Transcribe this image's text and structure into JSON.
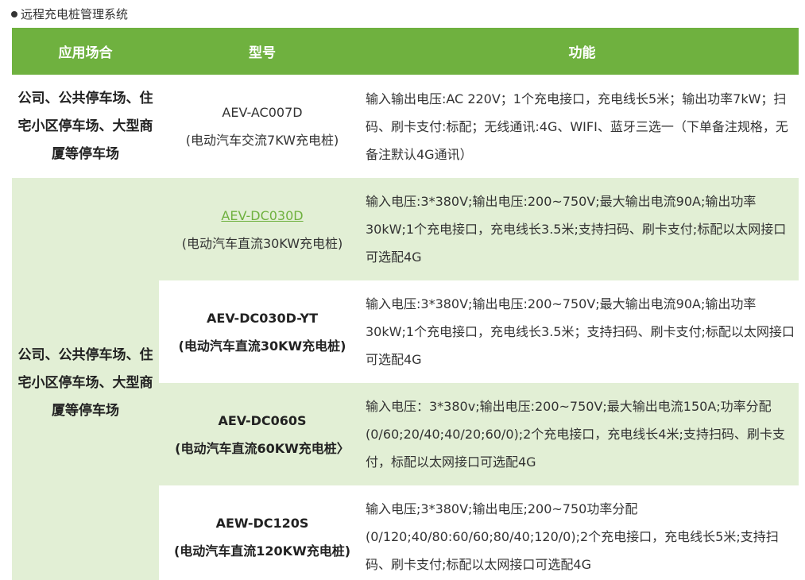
{
  "section": {
    "title": "远程充电桩管理系统"
  },
  "table": {
    "headers": {
      "scenario": "应用场合",
      "model": "型号",
      "function": "功能"
    },
    "rows": [
      {
        "scenario": "公司、公共停车场、住宅小区停车场、大型商厦等停车场",
        "model": "AEV-AC007D",
        "model_desc": "(电动汽车交流7KW充电桩)",
        "function": "输入输出电压:AC 220V；1个充电接口，充电线长5米；输出功率7kW；扫码、刷卡支付:标配；无线通讯:4G、WIFI、蓝牙三选一（下单备注规格，无备注默认4G通讯）"
      },
      {
        "scenario": "公司、公共停车场、住宅小区停车场、大型商厦等停车场",
        "model": "AEV-DC030D",
        "model_desc": "(电动汽车直流30KW充电桩)",
        "function": "输入电压:3*380V;输出电压:200~750V;最大输出电流90A;输出功率30kW;1个充电接口，充电线长3.5米;支持扫码、刷卡支付;标配以太网接口可选配4G"
      },
      {
        "model": "AEV-DC030D-YT",
        "model_desc": "(电动汽车直流30KW充电桩)",
        "function": "输入电压:3*380V;输出电压:200~750V;最大输出电流90A;输出功率30kW;1个充电接口，充电线长3.5米；支持扫码、刷卡支付;标配以太网接口可选配4G"
      },
      {
        "model": "AEV-DC060S",
        "model_desc": "(电动汽车直流60KW充电桩〉",
        "function": "输入电压：3*380v;输出电压:200~750V;最大输出电流150A;功率分配(0/60;20/40;40/20;60/0);2个充电接口，充电线长4米;支持扫码、刷卡支付，标配以太网接口可选配4G"
      },
      {
        "model": "AEW-DC120S",
        "model_desc": "(电动汽车直流120KW充电桩)",
        "function": "输入电压;3*380V;输出电压;200~750功率分配(0/120;40/80:60/60;80/40;120/0);2个充电接口，充电线长5米;支持扫码、刷卡支付;标配以太网接口可选配4G"
      }
    ]
  },
  "colors": {
    "header_bg": "#6fb13f",
    "row_alt_bg": "#e2efd5",
    "link": "#6fb13f"
  }
}
